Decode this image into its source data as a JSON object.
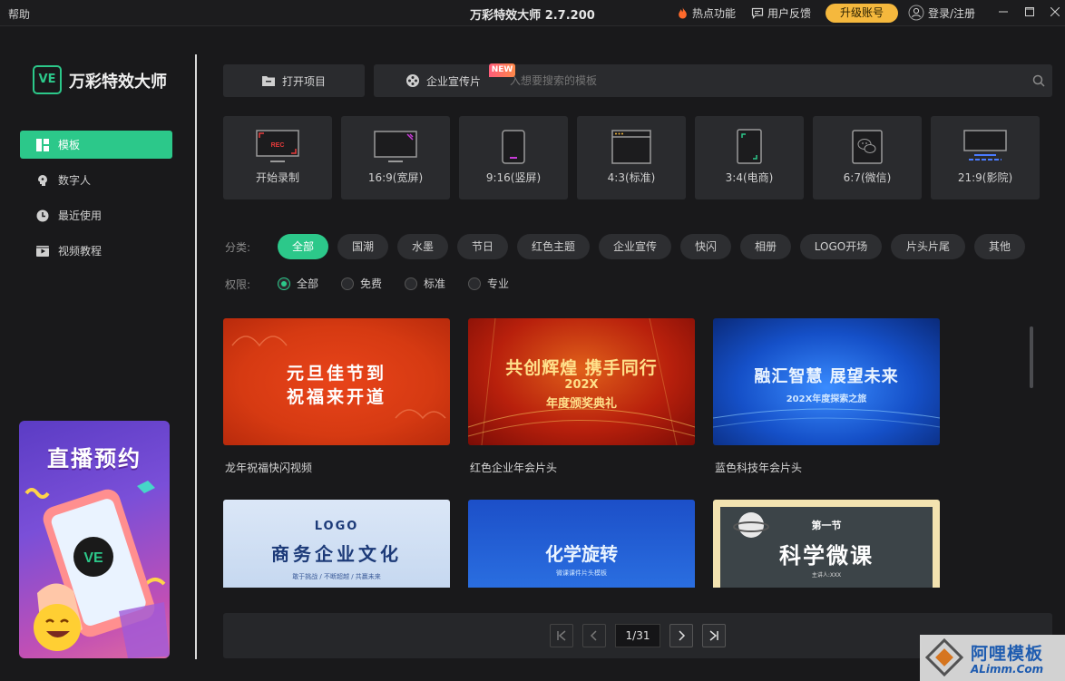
{
  "titlebar": {
    "help": "帮助",
    "title": "万彩特效大师 2.7.200",
    "hot": "热点功能",
    "feedback": "用户反馈",
    "upgrade": "升级账号",
    "login": "登录/注册"
  },
  "brand": {
    "logo": "VE",
    "name": "万彩特效大师"
  },
  "sidebar": {
    "items": [
      {
        "label": "模板",
        "icon": "template-icon"
      },
      {
        "label": "数字人",
        "icon": "digital-human-icon"
      },
      {
        "label": "最近使用",
        "icon": "clock-icon"
      },
      {
        "label": "视频教程",
        "icon": "video-tutorial-icon"
      }
    ],
    "banner": {
      "title": "直播预约",
      "logo": "VE"
    }
  },
  "toolbar": {
    "open_project": "打开项目",
    "enterprise": "企业宣传片",
    "new_badge": "NEW",
    "search_placeholder": "入想要搜索的模板"
  },
  "ratios": [
    {
      "label": "开始录制",
      "rec": "REC"
    },
    {
      "label": "16:9(宽屏)"
    },
    {
      "label": "9:16(竖屏)"
    },
    {
      "label": "4:3(标准)"
    },
    {
      "label": "3:4(电商)"
    },
    {
      "label": "6:7(微信)"
    },
    {
      "label": "21:9(影院)"
    }
  ],
  "filters": {
    "category_label": "分类:",
    "categories": [
      "全部",
      "国潮",
      "水墨",
      "节日",
      "红色主题",
      "企业宣传",
      "快闪",
      "相册",
      "LOGO开场",
      "片头片尾",
      "其他"
    ],
    "active_category": "全部",
    "permission_label": "权限:",
    "permissions": [
      "全部",
      "免费",
      "标准",
      "专业"
    ],
    "active_permission": "全部"
  },
  "templates": [
    {
      "caption": "龙年祝福快闪视频",
      "line1": "元旦佳节到",
      "line2": "祝福来开道"
    },
    {
      "caption": "红色企业年会片头",
      "line1": "共创辉煌 携手同行",
      "line2": "202X",
      "line3": "年度颁奖典礼"
    },
    {
      "caption": "蓝色科技年会片头",
      "line1": "融汇智慧 展望未来",
      "line2": "202X年度探索之旅"
    },
    {
      "caption": "",
      "line1": "LOGO",
      "line2": "商务企业文化",
      "line3": "敢于挑战 / 不断超越 / 共赢未来"
    },
    {
      "caption": "",
      "line1": "化学旋转",
      "line2": "微课课件片头模板"
    },
    {
      "caption": "",
      "line1": "第一节",
      "line2": "科学微课",
      "line3": "主讲人:XXX"
    }
  ],
  "pagination": {
    "current": "1/31"
  },
  "watermark": {
    "text": "阿哩模板",
    "sub": "ALimm.Com"
  },
  "colors": {
    "accent": "#2cc88a",
    "upgrade": "#f5b83d",
    "background": "#19191b",
    "card": "#2a2b2e"
  }
}
